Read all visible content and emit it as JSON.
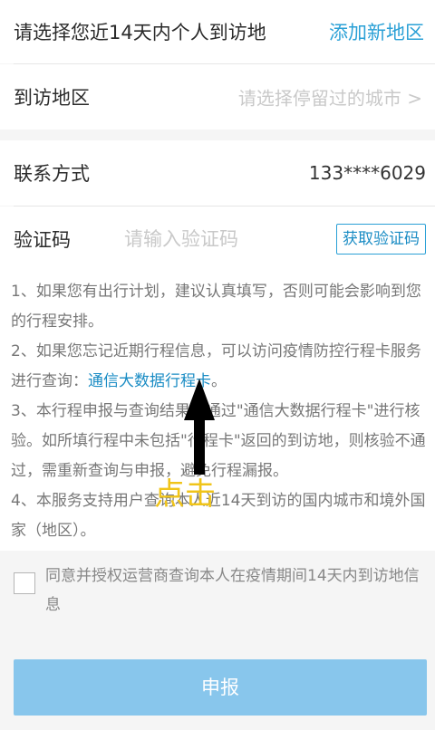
{
  "visit_area": {
    "prompt": "请选择您近14天内个人到访地",
    "add_button": "添加新地区",
    "row_label": "到访地区",
    "row_placeholder": "请选择停留过的城市 >"
  },
  "contact": {
    "label": "联系方式",
    "phone": "133****6029"
  },
  "verify": {
    "label": "验证码",
    "placeholder": "请输入验证码",
    "get_code_button": "获取验证码"
  },
  "notes": {
    "line1": "1、如果您有出行计划，建议认真填写，否则可能会影响到您的行程安排。",
    "line2_prefix": "2、如果您忘记近期行程信息，可以访问疫情防控行程卡服务进行查询：",
    "line2_link": "通信大数据行程卡",
    "line2_suffix": "。",
    "line3": "3、本行程申报与查询结果，通过\"通信大数据行程卡\"进行核验。如所填行程中未包括\"行程卡\"返回的到访地，则核验不通过，需重新查询与申报，避免行程漏报。",
    "line4": "4、本服务支持用户查询本人近14天到访的国内城市和境外国家（地区）。"
  },
  "consent": {
    "text": "同意并授权运营商查询本人在疫情期间14天内到访地信息"
  },
  "submit": {
    "label": "申报"
  },
  "annotation": {
    "label": "点击",
    "color": "#f0c419"
  }
}
